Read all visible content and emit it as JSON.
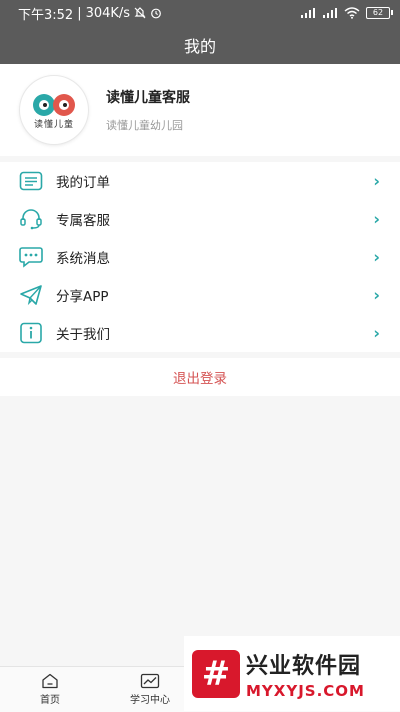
{
  "status_bar": {
    "time": "下午3:52",
    "network_speed": "304K/s",
    "battery": "62"
  },
  "header": {
    "title": "我的"
  },
  "profile": {
    "logo_text": "读懂儿童",
    "name": "读懂儿童客服",
    "school": "读懂儿童幼儿园"
  },
  "menu": {
    "items": [
      {
        "label": "我的订单",
        "icon": "order-list-icon"
      },
      {
        "label": "专属客服",
        "icon": "headset-icon"
      },
      {
        "label": "系统消息",
        "icon": "message-icon"
      },
      {
        "label": "分享APP",
        "icon": "share-plane-icon"
      },
      {
        "label": "关于我们",
        "icon": "info-icon"
      }
    ]
  },
  "logout_label": "退出登录",
  "tabbar": {
    "tabs": [
      {
        "label": "首页",
        "icon": "home-icon"
      },
      {
        "label": "学习中心",
        "icon": "chart-icon"
      }
    ]
  },
  "watermark": {
    "title": "兴业软件园",
    "url": "MYXYJS.COM"
  },
  "colors": {
    "header_bg": "#5b5b5b",
    "accent": "#2aa8a8",
    "logout": "#d55454",
    "watermark_red": "#d8182c"
  }
}
